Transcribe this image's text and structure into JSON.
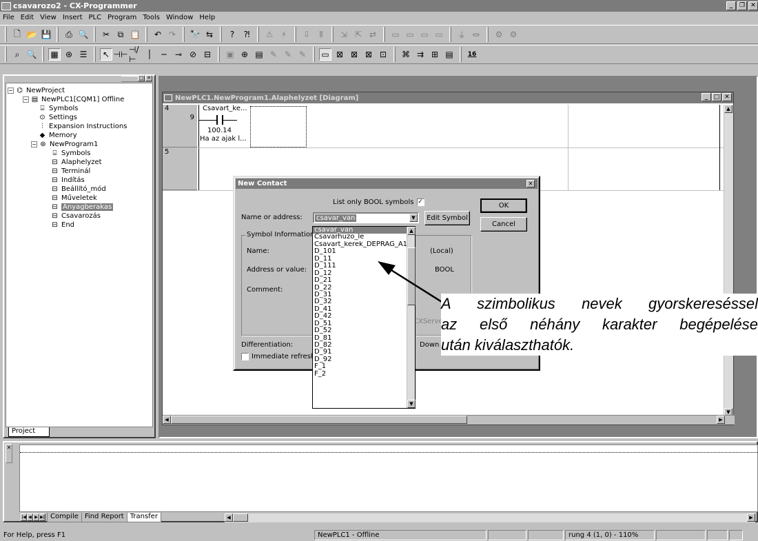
{
  "window": {
    "title": "csavarozo2 - CX-Programmer"
  },
  "menu": [
    "File",
    "Edit",
    "View",
    "Insert",
    "PLC",
    "Program",
    "Tools",
    "Window",
    "Help"
  ],
  "toolbar2": {
    "zoom_badge": "16"
  },
  "tree": {
    "project": "NewProject",
    "plc": "NewPLC1[CQM1] Offline",
    "plc_children": [
      "Symbols",
      "Settings",
      "Expansion Instructions",
      "Memory"
    ],
    "program": "NewProgram1",
    "program_children": [
      "Symbols",
      "Alaphelyzet",
      "Terminál",
      "Indítás",
      "Beállító_mód",
      "Műveletek",
      "Anyagberakas",
      "Csavarozás",
      "End"
    ],
    "tab": "Project"
  },
  "diagram": {
    "title": "NewPLC1.NewProgram1.Alaphelyzet [Diagram]",
    "rung1_num": "4",
    "rung1_step": "9",
    "contact_symbol": "Csavart_ke...",
    "contact_addr": "100.14",
    "contact_comment": "Ha az ajak l...",
    "rung2_num": "5"
  },
  "dialog": {
    "title": "New Contact",
    "list_only_bool": "List only BOOL symbols",
    "name_label": "Name or address:",
    "name_value": "csavar_van",
    "edit_symbol": "Edit Symbol",
    "ok": "OK",
    "cancel": "Cancel",
    "symbol_info": "Symbol Information",
    "name_field": "Name:",
    "local": "(Local)",
    "address_label": "Address or value:",
    "bool": "BOOL",
    "comment_label": "Comment:",
    "server_frag": "CXServer",
    "differentiation": "Differentiation:",
    "down": "Down",
    "immediate": "Immediate refresh"
  },
  "dropdown_items": [
    "csavar_van",
    "Csavarhuzo_le",
    "Csavart_kerek_DEPRAG_A1",
    "D_101",
    "D_11",
    "D_111",
    "D_12",
    "D_21",
    "D_22",
    "D_31",
    "D_32",
    "D_41",
    "D_42",
    "D_51",
    "D_52",
    "D_81",
    "D_82",
    "D_91",
    "D_92",
    "F_1",
    "F_2"
  ],
  "annotation": {
    "line1": "A szimbolikus nevek gyorskereséssel",
    "line2": "az első néhány karakter begépelése",
    "line3": "után kiválaszthatók."
  },
  "output": {
    "tabs": [
      "Compile",
      "Find Report",
      "Transfer"
    ]
  },
  "status": {
    "help": "For Help, press F1",
    "plc": "NewPLC1 - Offline",
    "rung": "rung 4 (1, 0)  - 110%"
  }
}
